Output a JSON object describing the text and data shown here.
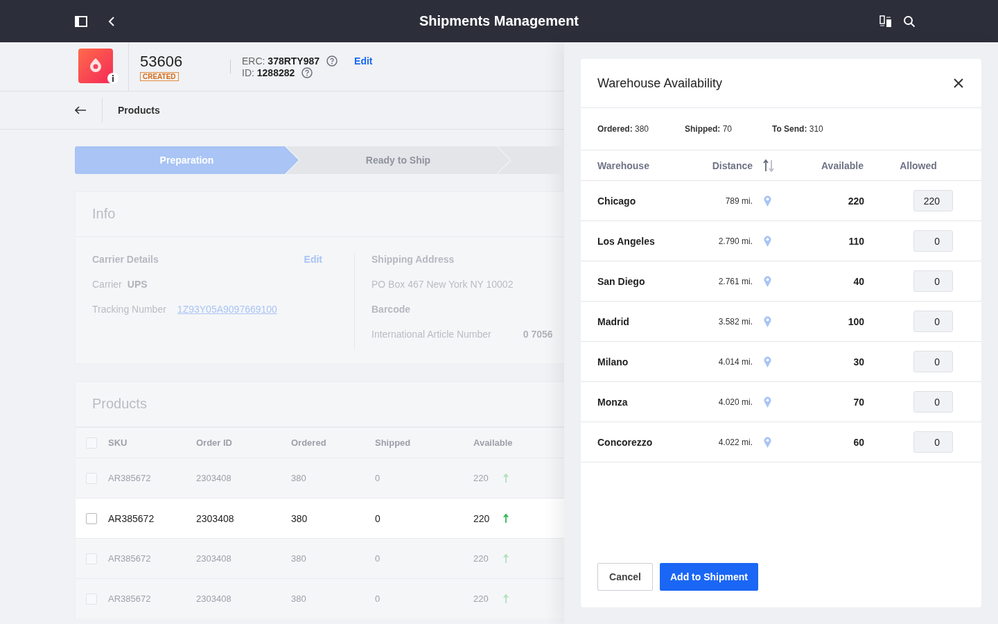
{
  "app_bar": {
    "title": "Shipments Management"
  },
  "shipment": {
    "number": "53606",
    "status": "CREATED",
    "erc_label": "ERC:",
    "erc": "378RTY987",
    "id_label": "ID:",
    "id": "1288282",
    "edit": "Edit"
  },
  "sub_header": {
    "title": "Products"
  },
  "steps": [
    {
      "label": "Preparation",
      "selected": true
    },
    {
      "label": "Ready to Ship",
      "selected": false
    }
  ],
  "info": {
    "title": "Info",
    "carrier_details": {
      "title": "Carrier Details",
      "edit": "Edit",
      "carrier_label": "Carrier",
      "carrier": "UPS",
      "tracking_label": "Tracking Number",
      "tracking": "1Z93Y05A9097669100"
    },
    "shipping_address": {
      "title": "Shipping Address",
      "address": "PO Box 467 New York NY 10002",
      "barcode_title": "Barcode",
      "ean_label": "International Article Number",
      "ean": "0 7056"
    }
  },
  "products": {
    "title": "Products",
    "header_checked": false,
    "columns": [
      "SKU",
      "Order ID",
      "Ordered",
      "Shipped",
      "Available"
    ],
    "rows": [
      {
        "sku": "AR385672",
        "order_id": "2303408",
        "ordered": "380",
        "shipped": "0",
        "available": "220",
        "checked": false,
        "selected": false
      },
      {
        "sku": "AR385672",
        "order_id": "2303408",
        "ordered": "380",
        "shipped": "0",
        "available": "220",
        "checked": false,
        "selected": true
      },
      {
        "sku": "AR385672",
        "order_id": "2303408",
        "ordered": "380",
        "shipped": "0",
        "available": "220",
        "checked": false,
        "selected": false
      },
      {
        "sku": "AR385672",
        "order_id": "2303408",
        "ordered": "380",
        "shipped": "0",
        "available": "220",
        "checked": false,
        "selected": false
      }
    ]
  },
  "dialog": {
    "title": "Warehouse Availability",
    "summary": [
      {
        "label": "Ordered:",
        "value": "380"
      },
      {
        "label": "Shipped:",
        "value": "70"
      },
      {
        "label": "To Send:",
        "value": "310"
      }
    ],
    "columns": [
      "Warehouse",
      "Distance",
      "Available",
      "Allowed"
    ],
    "rows": [
      {
        "warehouse": "Chicago",
        "distance": "789 mi.",
        "available": "220",
        "allowed": "220"
      },
      {
        "warehouse": "Los Angeles",
        "distance": "2.790 mi.",
        "available": "110",
        "allowed": "0"
      },
      {
        "warehouse": "San Diego",
        "distance": "2.761 mi.",
        "available": "40",
        "allowed": "0"
      },
      {
        "warehouse": "Madrid",
        "distance": "3.582 mi.",
        "available": "100",
        "allowed": "0"
      },
      {
        "warehouse": "Milano",
        "distance": "4.014 mi.",
        "available": "30",
        "allowed": "0"
      },
      {
        "warehouse": "Monza",
        "distance": "4.020 mi.",
        "available": "70",
        "allowed": "0"
      },
      {
        "warehouse": "Concorezzo",
        "distance": "4.022 mi.",
        "available": "60",
        "allowed": "0"
      }
    ],
    "buttons": {
      "cancel": "Cancel",
      "confirm": "Add to Shipment"
    }
  }
}
